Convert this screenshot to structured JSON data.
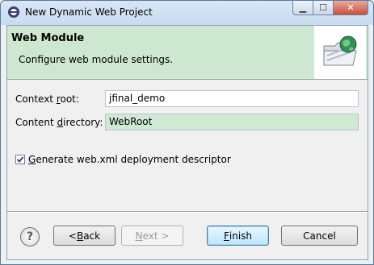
{
  "window": {
    "title": "New Dynamic Web Project",
    "minimize_glyph": "▁",
    "maximize_glyph": "☐",
    "close_glyph": "✕"
  },
  "banner": {
    "title": "Web Module",
    "description": "Configure web module settings.",
    "image": "web-folder-globe-icon"
  },
  "form": {
    "context_root_label": "Context root:",
    "context_root_value": "jfinal_demo",
    "content_directory_label": "Content directory:",
    "content_directory_value": "WebRoot",
    "generate_label": "Generate web.xml deployment descriptor",
    "generate_checked": true
  },
  "buttons": {
    "help": "?",
    "back": "< Back",
    "next": "Next >",
    "finish": "Finish",
    "cancel": "Cancel"
  },
  "colors": {
    "banner_bg": "#cde7d0",
    "focused_field_bg": "#cfe9d3",
    "default_button_border": "#3c7fb1"
  }
}
